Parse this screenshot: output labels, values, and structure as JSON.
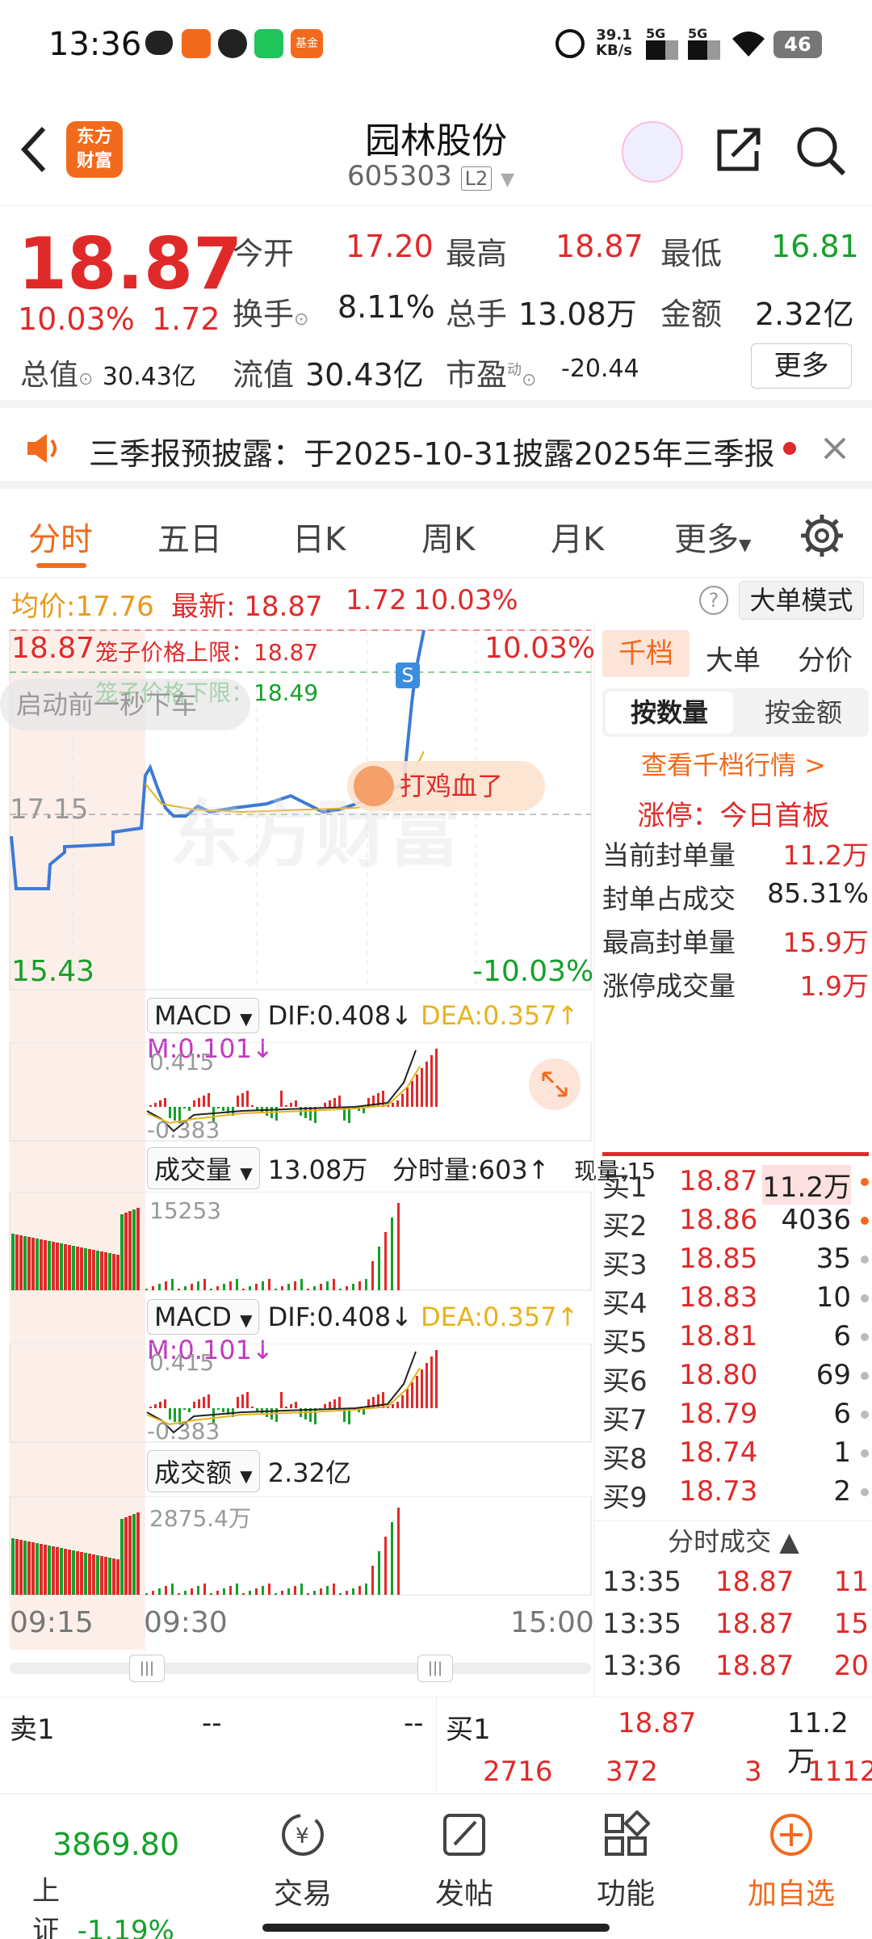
{
  "status": {
    "time": "13:36",
    "net": "39.1",
    "net_unit": "KB/s",
    "sig1": "5G",
    "sig2": "5G",
    "battery": "46",
    "app_badge": "基金"
  },
  "header": {
    "name": "园林股份",
    "code": "605303",
    "level": "L2",
    "logo_line1": "东方",
    "logo_line2": "财富"
  },
  "quote": {
    "price": "18.87",
    "pct": "10.03%",
    "chg": "1.72",
    "open_label": "今开",
    "open": "17.20",
    "high_label": "最高",
    "high": "18.87",
    "low_label": "最低",
    "low": "16.81",
    "turnover_label": "换手",
    "turnover": "8.11%",
    "vol_label": "总手",
    "vol": "13.08万",
    "amt_label": "金额",
    "amt": "2.32亿",
    "mcap_label": "总值",
    "mcap": "30.43亿",
    "float_label": "流值",
    "float": "30.43亿",
    "pe_label": "市盈",
    "pe_sup": "动",
    "pe": "-20.44",
    "more": "更多"
  },
  "notice": {
    "text": "三季报预披露：于2025-10-31披露2025年三季报"
  },
  "tabs": [
    "分时",
    "五日",
    "日K",
    "周K",
    "月K",
    "更多"
  ],
  "info": {
    "avg_label": "均价:",
    "avg": "17.76",
    "last_label": "最新:",
    "last": "18.87",
    "chg": "1.72",
    "pct": "10.03%",
    "mode": "大单模式"
  },
  "chart": {
    "top_price": "18.87",
    "top_pct": "10.03%",
    "mid_price": "17.15",
    "low_price": "15.43",
    "low_pct": "-10.03%",
    "cage_up": "笼子价格上限：18.87",
    "cage_down": "笼子价格下限：18.49",
    "pre_open": "启动前一秒下车",
    "bubble": "打鸡血了",
    "s_mark": "S",
    "watermark": "东方财富"
  },
  "macd": {
    "label": "MACD",
    "dif": "DIF:0.408↓",
    "dea": "DEA:0.357↑",
    "m": "M:0.101↓",
    "top": "0.415",
    "bottom": "-0.383"
  },
  "volume": {
    "label": "成交量",
    "total": "13.08万",
    "min": "分时量:603↑",
    "now": "现量:15",
    "top": "15253"
  },
  "amount": {
    "label": "成交额",
    "total": "2.32亿",
    "top": "2875.4万"
  },
  "time_axis": {
    "t1": "09:15",
    "t2": "09:30",
    "t3": "15:00"
  },
  "right": {
    "tab1": "千档",
    "tab2": "大单",
    "tab3": "分价",
    "sub1": "按数量",
    "sub2": "按金额",
    "link": "查看千档行情 >",
    "limit_title": "涨停：今日首板",
    "stats": [
      {
        "k": "当前封单量",
        "v": "11.2万"
      },
      {
        "k": "封单占成交",
        "v": "85.31%"
      },
      {
        "k": "最高封单量",
        "v": "15.9万"
      },
      {
        "k": "涨停成交量",
        "v": "1.9万"
      }
    ],
    "book": [
      {
        "n": "买1",
        "p": "18.87",
        "q": "11.2万"
      },
      {
        "n": "买2",
        "p": "18.86",
        "q": "4036"
      },
      {
        "n": "买3",
        "p": "18.85",
        "q": "35"
      },
      {
        "n": "买4",
        "p": "18.83",
        "q": "10"
      },
      {
        "n": "买5",
        "p": "18.81",
        "q": "6"
      },
      {
        "n": "买6",
        "p": "18.80",
        "q": "69"
      },
      {
        "n": "买7",
        "p": "18.79",
        "q": "6"
      },
      {
        "n": "买8",
        "p": "18.74",
        "q": "1"
      },
      {
        "n": "买9",
        "p": "18.73",
        "q": "2"
      }
    ],
    "ticks_title": "分时成交",
    "ticks": [
      {
        "t": "13:35",
        "p": "18.87",
        "q": "11"
      },
      {
        "t": "13:35",
        "p": "18.87",
        "q": "15"
      },
      {
        "t": "13:36",
        "p": "18.87",
        "q": "20"
      }
    ]
  },
  "bottom_quote": {
    "sell1": "卖1",
    "sell_p": "--",
    "sell_q": "--",
    "buy1": "买1",
    "buy_p": "18.87",
    "buy_q": "11.2万",
    "n1": "2716",
    "n2": "372",
    "n3": "3",
    "n4": "1112"
  },
  "nav": {
    "index_val": "3869.80",
    "index_name": "上证",
    "index_pct": "-1.19%",
    "trade": "交易",
    "post": "发帖",
    "func": "功能",
    "add": "加自选"
  }
}
